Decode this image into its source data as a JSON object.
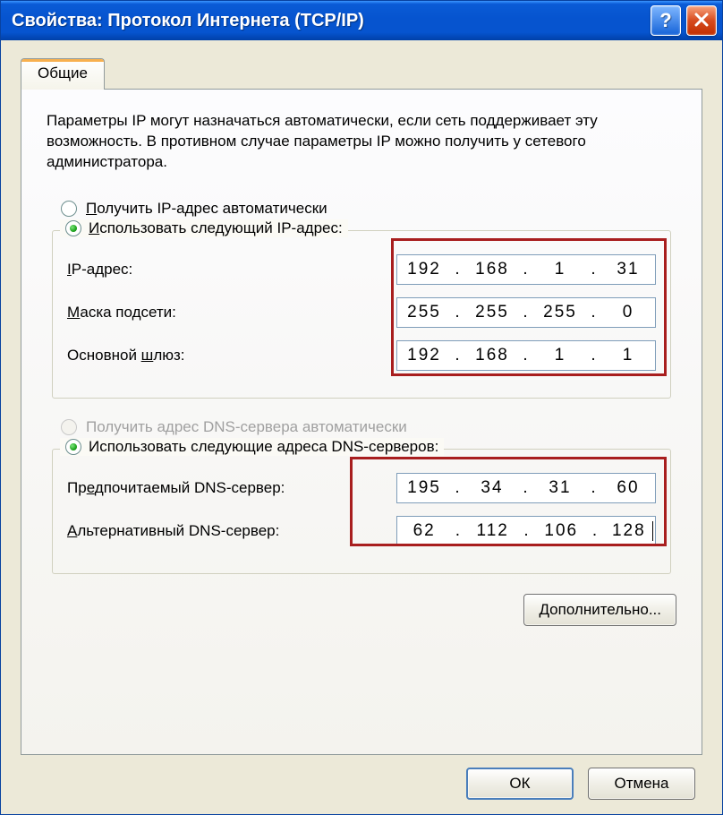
{
  "window": {
    "title": "Свойства: Протокол Интернета (TCP/IP)"
  },
  "tab": {
    "label": "Общие"
  },
  "description": "Параметры IP могут назначаться автоматически, если сеть поддерживает эту возможность. В противном случае параметры IP можно получить у сетевого администратора.",
  "radios": {
    "auto_ip": "Получить IP-адрес автоматически",
    "manual_ip": "Использовать следующий IP-адрес:",
    "auto_dns": "Получить адрес DNS-сервера автоматически",
    "manual_dns": "Использовать следующие адреса DNS-серверов:"
  },
  "ip_fields": {
    "ip_label": "IP-адрес:",
    "mask_label": "Маска подсети:",
    "gateway_label": "Основной шлюз:",
    "ip": [
      "192",
      "168",
      "1",
      "31"
    ],
    "mask": [
      "255",
      "255",
      "255",
      "0"
    ],
    "gateway": [
      "192",
      "168",
      "1",
      "1"
    ]
  },
  "dns_fields": {
    "pref_label": "Предпочитаемый DNS-сервер:",
    "alt_label": "Альтернативный DNS-сервер:",
    "pref": [
      "195",
      "34",
      "31",
      "60"
    ],
    "alt": [
      "62",
      "112",
      "106",
      "128"
    ]
  },
  "buttons": {
    "advanced": "Дополнительно...",
    "ok": "ОК",
    "cancel": "Отмена"
  },
  "underline_hints": {
    "auto_ip_letter": "П",
    "manual_ip_letter": "И",
    "ip_letter": "I",
    "mask_letter": "М",
    "gateway_letter": "ш",
    "pref_letter": "е",
    "alt_letter": "А",
    "adv_letter": "Д"
  }
}
